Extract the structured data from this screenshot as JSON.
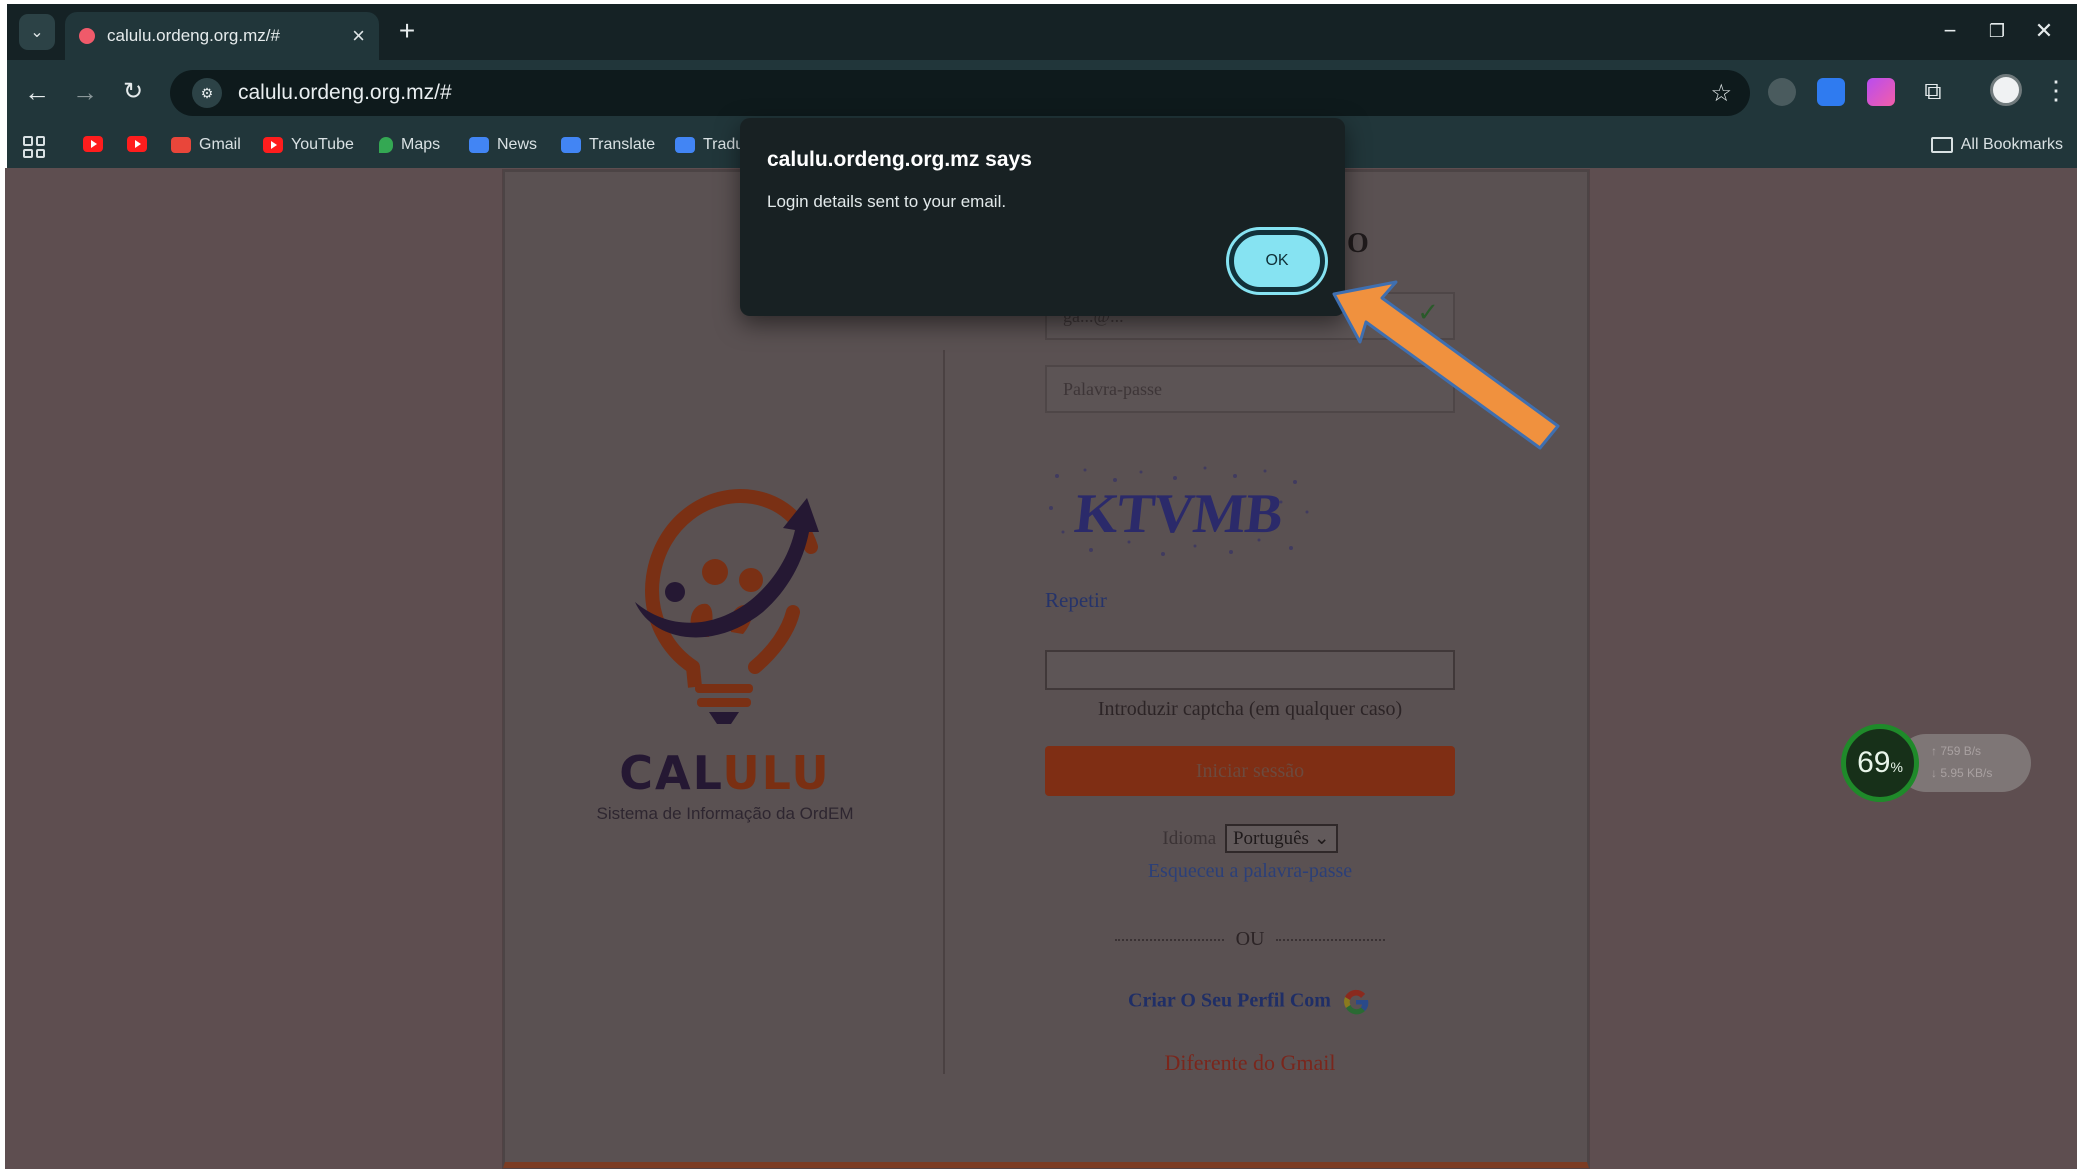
{
  "browser": {
    "tab_title": "calulu.ordeng.org.mz/#",
    "url": "calulu.ordeng.org.mz/#",
    "bookmarks": [
      {
        "label": "",
        "icon": "youtube-icon"
      },
      {
        "label": "",
        "icon": "youtube-icon"
      },
      {
        "label": "Gmail",
        "icon": "gmail-icon"
      },
      {
        "label": "YouTube",
        "icon": "youtube-icon"
      },
      {
        "label": "Maps",
        "icon": "maps-icon"
      },
      {
        "label": "News",
        "icon": "news-icon"
      },
      {
        "label": "Translate",
        "icon": "translate-icon"
      },
      {
        "label": "Tradu",
        "icon": "translate-icon"
      }
    ],
    "all_bookmarks_label": "All Bookmarks"
  },
  "alert": {
    "title": "calulu.ordeng.org.mz says",
    "message": "Login details sent to your email.",
    "ok_label": "OK"
  },
  "login": {
    "heading_fragment": "O",
    "email_value": "ga...@...",
    "password_placeholder": "Palavra-passe",
    "captcha_text": "KTVMB",
    "repeat_label": "Repetir",
    "captcha_hint": "Introduzir captcha (em qualquer caso)",
    "submit_label": "Iniciar sessão",
    "language_label": "Idioma",
    "language_value": "Português",
    "forgot_label": "Esqueceu a palavra-passe",
    "or_label": "OU",
    "google_signup_label": "Criar O Seu Perfil Com",
    "other_email_label": "Diferente do Gmail"
  },
  "logo": {
    "name_part1": "CAL",
    "name_part2": "ULU",
    "subtitle": "Sistema de Informação da OrdEM"
  },
  "network_widget": {
    "percent": "69",
    "percent_unit": "%",
    "upload": "759 B/s",
    "download": "5.95 KB/s"
  },
  "colors": {
    "annotation_arrow": "#f0913e",
    "ok_button": "#86e3f2",
    "submit_button": "#7f2e14"
  }
}
